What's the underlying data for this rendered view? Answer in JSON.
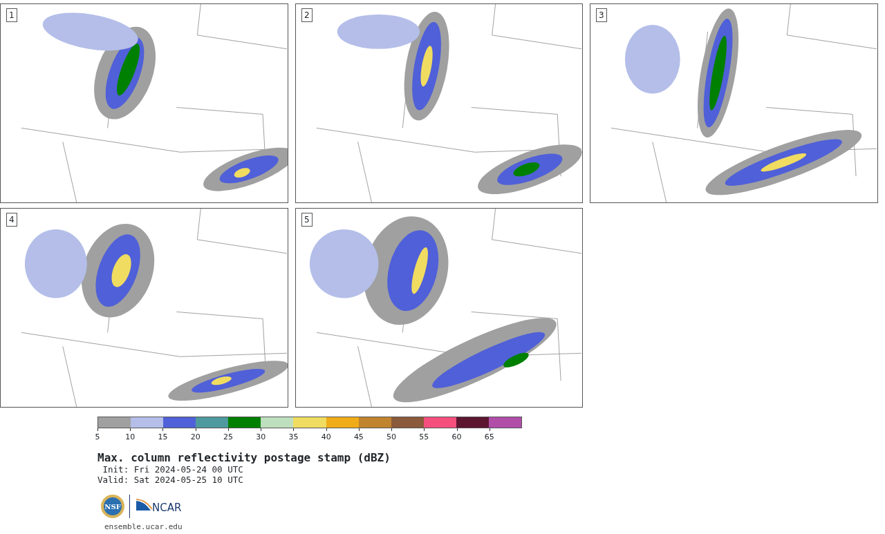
{
  "panels": [
    {
      "label": "1"
    },
    {
      "label": "2"
    },
    {
      "label": "3"
    },
    {
      "label": "4"
    },
    {
      "label": "5"
    }
  ],
  "colorbar": {
    "segments": [
      {
        "tick": "5",
        "color": "#a0a0a0"
      },
      {
        "tick": "10",
        "color": "#b4bee9"
      },
      {
        "tick": "15",
        "color": "#5060d8"
      },
      {
        "tick": "20",
        "color": "#4e9a9e"
      },
      {
        "tick": "25",
        "color": "#008000"
      },
      {
        "tick": "30",
        "color": "#bedfbe"
      },
      {
        "tick": "35",
        "color": "#f0dc60"
      },
      {
        "tick": "40",
        "color": "#f0ac18"
      },
      {
        "tick": "45",
        "color": "#c0832e"
      },
      {
        "tick": "50",
        "color": "#8a5a3c"
      },
      {
        "tick": "55",
        "color": "#f44f7d"
      },
      {
        "tick": "60",
        "color": "#5c1630"
      },
      {
        "tick": "65",
        "color": "#b04ea8"
      }
    ]
  },
  "title": "Max. column reflectivity postage stamp (dBZ)",
  "init": " Init: Fri 2024-05-24 00 UTC",
  "valid": "Valid: Sat 2024-05-25 10 UTC",
  "logos": {
    "nsf": "NSF",
    "ncar": "NCAR"
  },
  "url": "ensemble.ucar.edu"
}
